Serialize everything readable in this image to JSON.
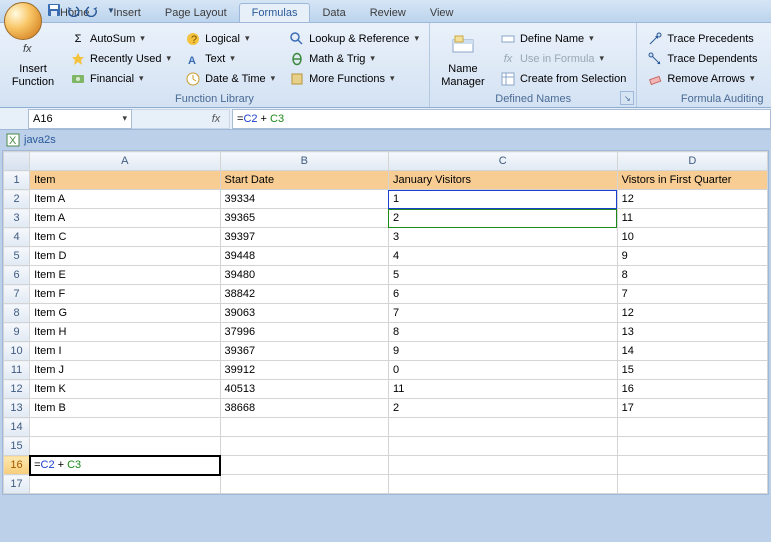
{
  "qat": {
    "save": "save",
    "undo": "undo",
    "redo": "redo"
  },
  "tabs": [
    "Home",
    "Insert",
    "Page Layout",
    "Formulas",
    "Data",
    "Review",
    "View"
  ],
  "active_tab": "Formulas",
  "ribbon": {
    "group1": {
      "label": "Function Library",
      "insert_function": "Insert\nFunction",
      "autosum": "AutoSum",
      "recently": "Recently Used",
      "financial": "Financial",
      "logical": "Logical",
      "text": "Text",
      "datetime": "Date & Time",
      "lookup": "Lookup & Reference",
      "math": "Math & Trig",
      "more": "More Functions"
    },
    "group2": {
      "label": "Defined Names",
      "name_manager": "Name\nManager",
      "define": "Define Name",
      "use": "Use in Formula",
      "create": "Create from Selection"
    },
    "group3": {
      "label": "Formula Auditing",
      "precedents": "Trace Precedents",
      "dependents": "Trace Dependents",
      "remove": "Remove Arrows"
    }
  },
  "namebox": "A16",
  "formula": "=C2 + C3",
  "formula_parts": {
    "eq": "=",
    "a": "C2",
    "plus": " + ",
    "b": "C3"
  },
  "workbook": "java2s",
  "columns": [
    "A",
    "B",
    "C",
    "D"
  ],
  "headers": {
    "A": "Item",
    "B": "Start Date",
    "C": "January Visitors",
    "D": "Vistors in First Quarter"
  },
  "rows": [
    {
      "n": 1,
      "A": "Item",
      "B": "Start Date",
      "C": "January Visitors",
      "D": "Vistors in First Quarter",
      "header": true
    },
    {
      "n": 2,
      "A": "Item A",
      "B": "39334",
      "C": "1",
      "D": "12"
    },
    {
      "n": 3,
      "A": "Item A",
      "B": "39365",
      "C": "2",
      "D": "11"
    },
    {
      "n": 4,
      "A": "Item C",
      "B": "39397",
      "C": "3",
      "D": "10"
    },
    {
      "n": 5,
      "A": "Item D",
      "B": "39448",
      "C": "4",
      "D": "9"
    },
    {
      "n": 6,
      "A": "Item E",
      "B": "39480",
      "C": "5",
      "D": "8"
    },
    {
      "n": 7,
      "A": "Item F",
      "B": "38842",
      "C": "6",
      "D": "7"
    },
    {
      "n": 8,
      "A": "Item G",
      "B": "39063",
      "C": "7",
      "D": "12"
    },
    {
      "n": 9,
      "A": "Item H",
      "B": "37996",
      "C": "8",
      "D": "13"
    },
    {
      "n": 10,
      "A": "Item I",
      "B": "39367",
      "C": "9",
      "D": "14"
    },
    {
      "n": 11,
      "A": "Item J",
      "B": "39912",
      "C": "0",
      "D": "15"
    },
    {
      "n": 12,
      "A": "Item K",
      "B": "40513",
      "C": "11",
      "D": "16"
    },
    {
      "n": 13,
      "A": "Item B",
      "B": "38668",
      "C": "2",
      "D": "17"
    },
    {
      "n": 14,
      "A": "",
      "B": "",
      "C": "",
      "D": ""
    },
    {
      "n": 15,
      "A": "",
      "B": "",
      "C": "",
      "D": ""
    },
    {
      "n": 16,
      "A": "=C2 + C3",
      "B": "",
      "C": "",
      "D": "",
      "editing": true
    },
    {
      "n": 17,
      "A": "",
      "B": "",
      "C": "",
      "D": ""
    }
  ]
}
